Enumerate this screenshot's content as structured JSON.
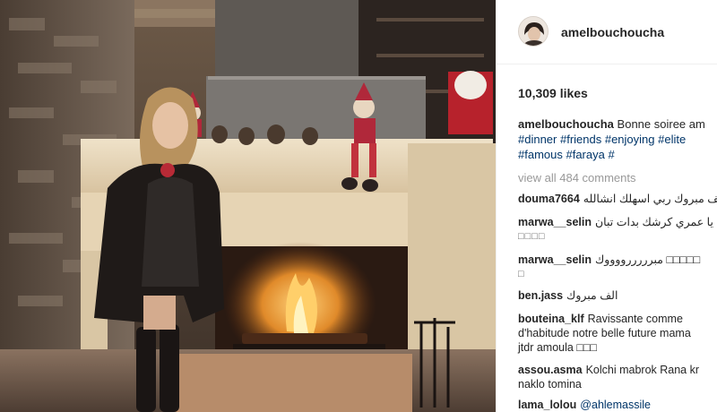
{
  "post": {
    "username": "amelbouchoucha",
    "likes": "10,309 likes",
    "caption": {
      "username": "amelbouchoucha",
      "text": "Bonne soiree am",
      "tags_line1": "#dinner #friends #enjoying #elite",
      "tags_line2": "#famous #faraya #"
    },
    "view_all": "view all 484 comments"
  },
  "comments": [
    {
      "user": "douma7664",
      "text": "الف مبروك ربي اسهلك انشالله"
    },
    {
      "user": "marwa__selin",
      "text": "يا عمري كرشك بدات تبان",
      "line2": "□□□□"
    },
    {
      "user": "marwa__selin",
      "text": "مبرررررووووك □□□□□",
      "line2": "□"
    },
    {
      "user": "ben.jass",
      "text": "الف مبروك"
    },
    {
      "user": "bouteina_klf",
      "text": "Ravissante comme",
      "line2": "d'habitude notre belle future mama",
      "line3": "jtdr amoula □□□"
    },
    {
      "user": "assou.asma",
      "text": "Kolchi mabrok Rana kr",
      "line2": "naklo tomina"
    },
    {
      "user": "lama_lolou",
      "text": "@ahlemassile"
    }
  ],
  "colors": {
    "text": "#262626",
    "muted": "#999999",
    "hashtag": "#003569",
    "border": "#efefef"
  }
}
